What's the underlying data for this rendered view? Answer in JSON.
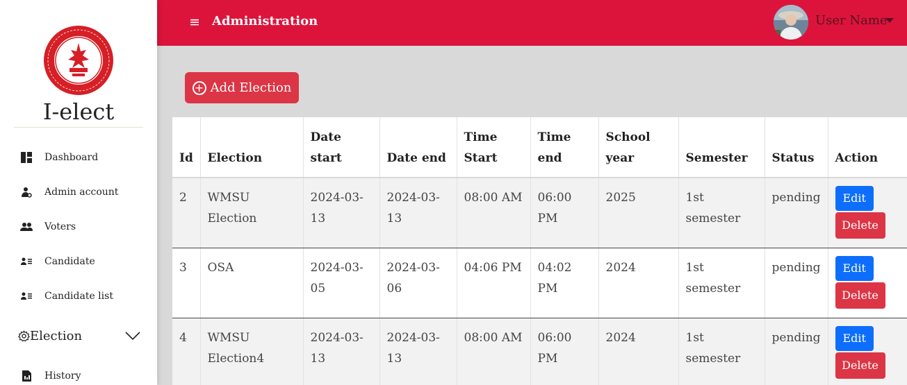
{
  "sidebar": {
    "brand": "I-elect",
    "items": [
      {
        "label": "Dashboard",
        "icon": "dashboard-icon"
      },
      {
        "label": "Admin account",
        "icon": "admin-user-icon"
      },
      {
        "label": "Voters",
        "icon": "users-icon"
      },
      {
        "label": "Candidate",
        "icon": "candidate-icon"
      },
      {
        "label": "Candidate list",
        "icon": "candidate-list-icon"
      }
    ],
    "election_group": {
      "label": "Election",
      "icon": "gear-icon"
    },
    "history": {
      "label": "History",
      "icon": "file-icon"
    }
  },
  "header": {
    "menu_glyph": "≡",
    "title": "Administration",
    "user_name": "User Name"
  },
  "toolbar": {
    "add_label": "Add Election"
  },
  "table": {
    "columns": [
      "Id",
      "Election",
      "Date start",
      "Date end",
      "Time Start",
      "Time end",
      "School year",
      "Semester",
      "Status",
      "Action"
    ],
    "rows": [
      {
        "id": "2",
        "election": "WMSU Election",
        "date_start": "2024-03-13",
        "date_end": "2024-03-13",
        "time_start": "08:00 AM",
        "time_end": "06:00 PM",
        "school_year": "2025",
        "semester": "1st semester",
        "status": "pending"
      },
      {
        "id": "3",
        "election": "OSA",
        "date_start": "2024-03-05",
        "date_end": "2024-03-06",
        "time_start": "04:06 PM",
        "time_end": "04:02 PM",
        "school_year": "2024",
        "semester": "1st semester",
        "status": "pending"
      },
      {
        "id": "4",
        "election": "WMSU Election4",
        "date_start": "2024-03-13",
        "date_end": "2024-03-13",
        "time_start": "08:00 AM",
        "time_end": "06:00 PM",
        "school_year": "2024",
        "semester": "1st semester",
        "status": "pending"
      }
    ],
    "edit_label": "Edit",
    "delete_label": "Delete"
  },
  "colors": {
    "topbar": "#dc143c",
    "danger": "#dc3545",
    "primary": "#0d6efd"
  }
}
